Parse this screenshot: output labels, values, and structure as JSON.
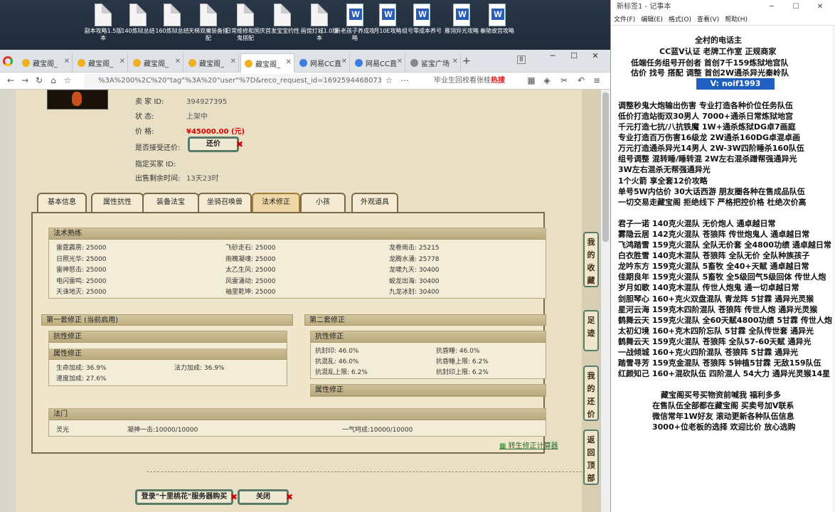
{
  "desktop": {
    "icons": [
      {
        "label": "副本攻略1.5版本",
        "icon": "text-file-icon"
      },
      {
        "label": "140炼狱总结",
        "icon": "text-file-icon"
      },
      {
        "label": "160炼狱总结",
        "icon": "text-file-icon"
      },
      {
        "label": "天梯双魔装备搭配",
        "icon": "text-file-icon"
      },
      {
        "label": "日常维修和国庆鬼搭配",
        "icon": "text-file-icon"
      },
      {
        "label": "首发宝宝约性",
        "icon": "text-file-icon"
      },
      {
        "label": "画馆灯城1.0版本",
        "icon": "text-file-icon"
      },
      {
        "label": "新老孩子养成攻略",
        "icon": "word-doc-icon"
      },
      {
        "label": "月10E攻略",
        "icon": "word-doc-icon"
      },
      {
        "label": "组号零成本养号",
        "icon": "word-doc-icon"
      },
      {
        "label": "雁翎异光攻略",
        "icon": "word-doc-icon"
      },
      {
        "label": "秦陵故宫攻略",
        "icon": "word-doc-icon"
      }
    ]
  },
  "browser": {
    "tabs": [
      "藏宝阁_",
      "藏宝阁_",
      "藏宝阁_",
      "藏宝阁_",
      "藏宝阁_",
      "网易CC直",
      "网易CC直",
      "鲨宝广场"
    ],
    "active_tab": 4,
    "tab_count": "8",
    "url": "%3A%200%2C%20\"tag\"%3A%20\"user\"%7D&reco_request_id=1692594468073ddNlA",
    "search_placeholder": "毕业生回校看张桂",
    "hot_label": "热搜"
  },
  "listing": {
    "seller_id_label": "卖 家 ID:",
    "seller_id": "394927395",
    "status_label": "状 态:",
    "status": "上架中",
    "price_label": "价 格:",
    "price": "¥45000.00 (元)",
    "counter_offer_label": "是否接受还价:",
    "counter_offer_button": "还价",
    "buyer_id_label": "指定买家 ID:",
    "time_left_label": "出售剩余时间:",
    "time_left": "13天23时"
  },
  "detail_tabs": [
    "基本信息",
    "属性抗性",
    "装备法宝",
    "坐骑召唤兽",
    "法术修正",
    "小孩",
    "外观道具"
  ],
  "selected_detail_tab": "法术修正",
  "skills": {
    "title": "法术熟练",
    "cells": [
      [
        "雷霆霹雳: 25000",
        "飞砂走石: 25000",
        "龙卷雨击: 25215"
      ],
      [
        "日照光华: 25000",
        "雨魄凝魂: 25000",
        "龙腾水涌: 25778"
      ],
      [
        "雷神怒击: 25000",
        "太乙生风: 25000",
        "龙啸九天: 30400"
      ],
      [
        "电闪雷鸣: 25000",
        "风雷涌动: 25000",
        "蛟龙出海: 30400"
      ],
      [
        "天诛地灭: 25000",
        "袖里乾坤: 25000",
        "九龙冰封: 30400"
      ]
    ]
  },
  "set1": {
    "title": "第一套修正 (当前启用)",
    "resist_title": "抗性修正",
    "attr_title": "属性修正",
    "attr_cells": [
      "生命加成: 36.9%",
      "法力加成: 36.9%",
      "速度加成: 27.6%"
    ]
  },
  "set2": {
    "title": "第二套修正",
    "resist_title": "抗性修正",
    "resist_cells": [
      "抗封印: 46.0%",
      "抗昏睡: 46.0%",
      "抗混乱: 46.0%",
      "抗昏睡上限: 6.2%",
      "抗混乱上限: 6.2%",
      "抗封印上限: 6.2%"
    ],
    "attr_title": "属性修正"
  },
  "magic": {
    "title": "法门",
    "cells": [
      "灵光",
      "凝神一击:10000/10000",
      "一气呵成:10000/10000"
    ]
  },
  "calc_link": "转生修正计算器",
  "bottom_buttons": {
    "login": "登录\"十里桃花\"服务器购买",
    "close": "关闭"
  },
  "right_nav": [
    "我的收藏",
    "足迹",
    "我的还价",
    "返回顶部"
  ],
  "notepad": {
    "title": "新标签1 - 记事本",
    "menu": [
      "文件(F)",
      "编辑(E)",
      "格式(O)",
      "查看(V)",
      "帮助(H)"
    ],
    "lines": [
      "全村的电话主",
      "CC蓝V认证  老牌工作室  正规商家",
      "低端任务组号开创者          首创7千159炼狱地宫队",
      "估价 找号 搭配 调整          首创2W通杀异光秦岭队",
      "V:  noif1993",
      "调整秒鬼大炮输出伤害        专业打造各种价位任务队伍",
      "低价打造站街双30男人          7000+通杀日常炼狱地宫",
      "千元打造七抗/八抗铁魔          1W+通杀炼狱DG卓7画庭",
      "专业打造百万伤害16级龙          2W通杀160DG卓混卓画",
      "万元打造通杀异光14男人        2W-3W四阶睡杀160队伍",
      "组号调整 混转睡/睡转混        2W左右混杀蹭帮强通异光",
      "                                                    3W左右混杀无帮强通异光",
      "1个火箭 享全套12价攻略",
      "单号5W内估价 30大话西游         朋友圈各种在售成品队伍",
      "一切交易走藏宝阁 拒绝线下      严格把控价格 杜绝次价高",
      "君子一诺 140克火混队 无价炮人 通卓越日常",
      "雾隐云居 142克火混队 苍狼阵 传世炮鬼人 通卓越日常",
      "飞鸿踏雪 159克火混队 全队无价套 全4800功绩 通卓越日常",
      "白衣胜雪 140克木混队 苍狼阵 全队无价 全队种族孩子",
      "龙吟东方 159克火混队 5畜牧 全40+天赋 通卓越日常",
      "佳期良年 159克火混队 5畜牧 全5级回气5级回体 传世人炮",
      "岁月如歌 140克木混队 传世人炮鬼 通一切卓越日常",
      "剑胆琴心 160+克火双盘混队 青龙阵 5甘霖 通异光灵猴",
      "星河云海 159克木四阶混队 苍狼阵 传世人炮 通异光灵猴",
      "鹤舞云天 159克火混队 全60天赋4800功绩 5甘霖 传世人炮",
      "太初幻境 160+克木四阶忘队 5甘霖 全队传世套 通异光",
      "鹤舞云天 159克火混队 苍狼阵 全队57-60天赋 通异光",
      "一战倾城 160+克火四阶混队 苍狼阵 5甘霖 通异光",
      "踏雪寻芳 159克金混队 苍狼阵 5钟植5甘霖 无敌159队伍",
      "红颜知己 160+混砍队伍 四阶混人 54大力 通异光灵猴14星",
      "藏宝阁买号买物资前喊我 福利多多",
      "在售队伍全部都在藏宝阁 买卖号加V联系",
      "微信常年1W好友 滚动更新各种队伍信息",
      "3000+位老板的选择 欢迎比价 放心选购"
    ]
  }
}
